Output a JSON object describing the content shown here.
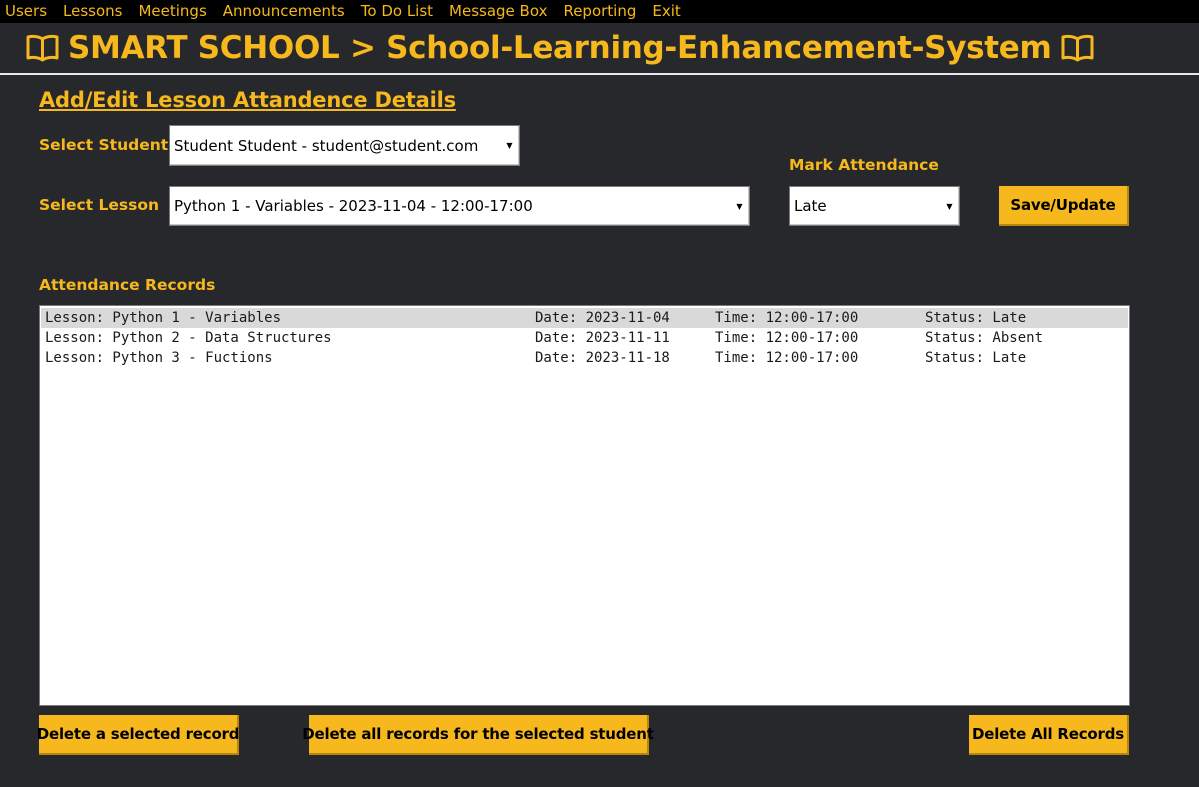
{
  "menu": [
    "Users",
    "Lessons",
    "Meetings",
    "Announcements",
    "To Do List",
    "Message Box",
    "Reporting",
    "Exit"
  ],
  "app_title": "SMART SCHOOL > School-Learning-Enhancement-System",
  "icons": {
    "title_left": "book-icon",
    "title_right": "book-icon",
    "dropdown": "chevron-down-icon"
  },
  "colors": {
    "accent": "#f6b81c",
    "background": "#27282c",
    "menubar": "#000000"
  },
  "form": {
    "heading": "Add/Edit Lesson Attandence Details",
    "student_label": "Select Student",
    "student_value": "Student Student - student@student.com",
    "lesson_label": "Select Lesson",
    "lesson_value": "Python 1 - Variables - 2023-11-04 - 12:00-17:00",
    "attendance_label": "Mark Attendance",
    "attendance_value": "Late",
    "save_label": "Save/Update"
  },
  "records": {
    "heading": "Attendance Records",
    "rows": [
      {
        "lesson": "Lesson: Python 1 - Variables",
        "date": "Date: 2023-11-04",
        "time": "Time: 12:00-17:00",
        "status": "Status: Late",
        "selected": true
      },
      {
        "lesson": "Lesson: Python 2 - Data Structures",
        "date": "Date: 2023-11-11",
        "time": "Time: 12:00-17:00",
        "status": "Status: Absent",
        "selected": false
      },
      {
        "lesson": "Lesson: Python 3 - Fuctions",
        "date": "Date: 2023-11-18",
        "time": "Time: 12:00-17:00",
        "status": "Status: Late",
        "selected": false
      }
    ]
  },
  "actions": {
    "delete_selected": "Delete a selected record",
    "delete_student": "Delete all records for the selected student",
    "delete_all": "Delete All Records"
  }
}
